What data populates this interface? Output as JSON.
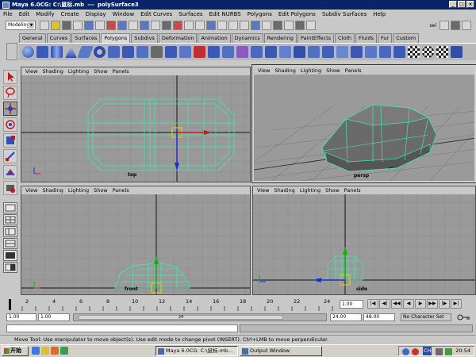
{
  "window": {
    "title": "Maya 6.0CG: C:\\鼠标.mb",
    "separator": "---",
    "object": "polySurface3",
    "buttons": [
      "_",
      "□",
      "×"
    ]
  },
  "menubar": [
    "File",
    "Edit",
    "Modify",
    "Create",
    "Display",
    "Window",
    "Edit Curves",
    "Surfaces",
    "Edit NURBS",
    "Polygons",
    "Edit Polygons",
    "Subdiv Surfaces",
    "Help"
  ],
  "mode": {
    "selected": "Modeling",
    "sel_label": "sel"
  },
  "shelf_tabs": [
    "General",
    "Curves",
    "Surfaces",
    "Polygons",
    "Subdivs",
    "Deformation",
    "Animation",
    "Dynamics",
    "Rendering",
    "PaintEffects",
    "Cloth",
    "Fluids",
    "Fur",
    "Custom"
  ],
  "active_shelf": "Polygons",
  "viewport_menu": [
    "View",
    "Shading",
    "Lighting",
    "Show",
    "Panels"
  ],
  "viewports": {
    "top": {
      "label": "top"
    },
    "persp": {
      "label": "persp"
    },
    "front": {
      "label": "front"
    },
    "side": {
      "label": "side"
    }
  },
  "timeline": {
    "ticks": [
      "2",
      "4",
      "6",
      "8",
      "10",
      "12",
      "14",
      "16",
      "18",
      "20",
      "22",
      "24"
    ],
    "current_frame": "1.00",
    "range_start": "1.00",
    "range_start_inner": "1.00",
    "range_handle_label": "24",
    "range_end_inner": "24.00",
    "range_end": "48.00",
    "character_set": "No Character Set",
    "playback": [
      "|◀",
      "◀|",
      "◀◀",
      "◀",
      "▶",
      "▶▶",
      "|▶",
      "▶|"
    ]
  },
  "help_line": "Move Tool: Use manipulator to move object(s). Use edit mode to change pivot (INSERT). Ctrl+LMB to move perpendicular.",
  "taskbar": {
    "start": "开始",
    "tasks": [
      {
        "label": "Maya 6.0CG: C:\\鼠标.mb...",
        "pressed": true
      },
      {
        "label": "Output Window",
        "pressed": false
      }
    ],
    "tray_lang": "CH",
    "clock": "20:54"
  },
  "colors": {
    "wire": "#3fe8b0",
    "axis_red": "#d01818",
    "axis_blue": "#1830d0",
    "axis_green": "#10b010",
    "title_bg": "#0a246a"
  }
}
